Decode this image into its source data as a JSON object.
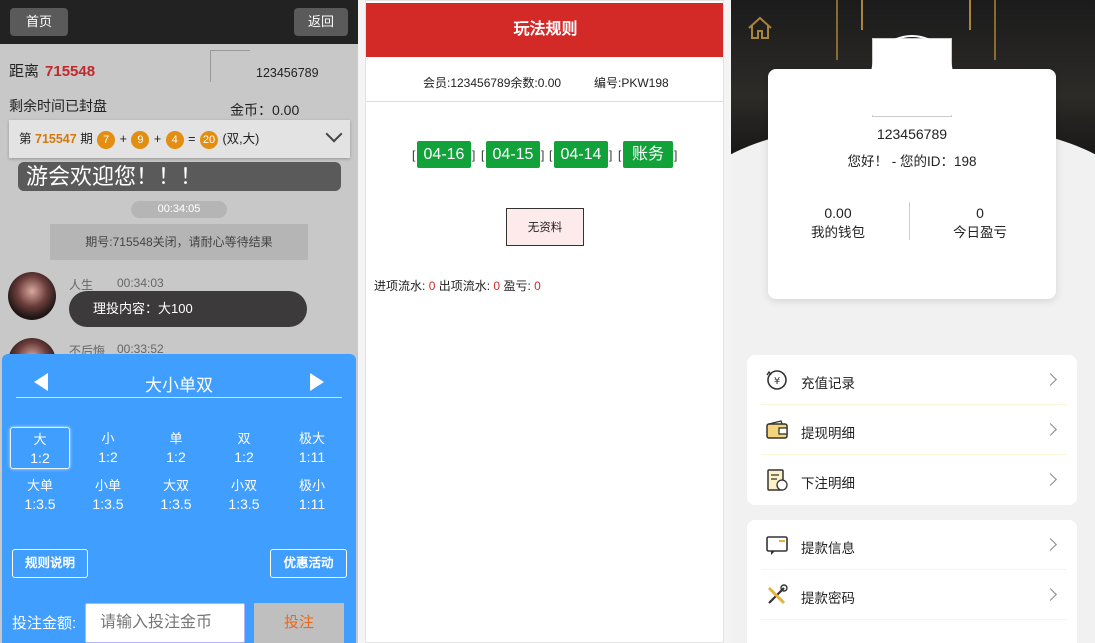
{
  "lobby": {
    "home_label": "首页",
    "back_label": "返回",
    "distance_label": "距离",
    "distance_issue": "715548",
    "remain_label": "剩余时间已封盘",
    "user_id": "123456789",
    "coin_label": "金币：0.00",
    "result": {
      "prefix": "第",
      "issue": "715547",
      "suffix": "期",
      "balls": [
        "7",
        "9",
        "4"
      ],
      "sum": "20",
      "tag": "(双,大)"
    },
    "marquee": "游会欢迎您！！！",
    "chat_time": "00:34:05",
    "notice": "期号:715548关闭，请耐心等待结果",
    "messages": [
      {
        "name": "人生",
        "time": "00:34:03",
        "text": "理投内容：大100"
      },
      {
        "name": "不后悔",
        "time": "00:33:52"
      }
    ],
    "bet": {
      "type_title": "大小单双",
      "options": [
        {
          "name": "大",
          "odds": "1:2"
        },
        {
          "name": "小",
          "odds": "1:2"
        },
        {
          "name": "单",
          "odds": "1:2"
        },
        {
          "name": "双",
          "odds": "1:2"
        },
        {
          "name": "极大",
          "odds": "1:11"
        },
        {
          "name": "大单",
          "odds": "1:3.5"
        },
        {
          "name": "小单",
          "odds": "1:3.5"
        },
        {
          "name": "大双",
          "odds": "1:3.5"
        },
        {
          "name": "小双",
          "odds": "1:3.5"
        },
        {
          "name": "极小",
          "odds": "1:11"
        }
      ],
      "rules_label": "规则说明",
      "promo_label": "优惠活动",
      "amount_label": "投注金额:",
      "amount_placeholder": "请输入投注金币",
      "submit_label": "投注"
    }
  },
  "rules": {
    "title": "玩法规则",
    "member": "会员:123456789余数:0.00",
    "code": "编号:PKW198",
    "dates": [
      "04-16",
      "04-15",
      "04-14",
      "账务"
    ],
    "no_data": "无资料",
    "flow": {
      "in_label": "进项流水:",
      "in_value": "0",
      "out_label": "出项流水:",
      "out_value": "0",
      "profit_label": "盈亏:",
      "profit_value": "0"
    }
  },
  "profile": {
    "username": "123456789",
    "greeting": "您好！ - 您的ID：198",
    "wallet_value": "0.00",
    "wallet_label": "我的钱包",
    "today_value": "0",
    "today_label": "今日盈亏",
    "menu1": [
      "充值记录",
      "提现明细",
      "下注明细"
    ],
    "menu2": [
      "提款信息",
      "提款密码"
    ]
  }
}
